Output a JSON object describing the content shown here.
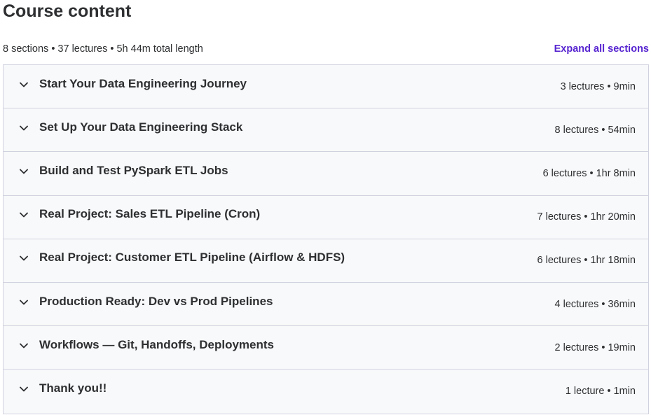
{
  "header": {
    "title": "Course content",
    "summary": "8 sections • 37 lectures • 5h 44m total length",
    "expand_all_label": "Expand all sections"
  },
  "sections": [
    {
      "title": "Start Your Data Engineering Journey",
      "info": "3 lectures • 9min"
    },
    {
      "title": "Set Up Your Data Engineering Stack",
      "info": "8 lectures • 54min"
    },
    {
      "title": "Build and Test PySpark ETL Jobs",
      "info": "6 lectures • 1hr 8min"
    },
    {
      "title": "Real Project: Sales ETL Pipeline (Cron)",
      "info": "7 lectures • 1hr 20min"
    },
    {
      "title": "Real Project: Customer ETL Pipeline (Airflow & HDFS)",
      "info": "6 lectures • 1hr 18min"
    },
    {
      "title": "Production Ready: Dev vs Prod Pipelines",
      "info": "4 lectures • 36min"
    },
    {
      "title": "Workflows — Git, Handoffs, Deployments",
      "info": "2 lectures • 19min"
    },
    {
      "title": "Thank you!!",
      "info": "1 lecture • 1min"
    }
  ],
  "icons": {
    "chevron": "chevron-down-icon"
  },
  "colors": {
    "accent": "#5624d0",
    "row_background": "#f7f9fa",
    "border": "#d1d2e0",
    "text": "#2d2f31"
  }
}
